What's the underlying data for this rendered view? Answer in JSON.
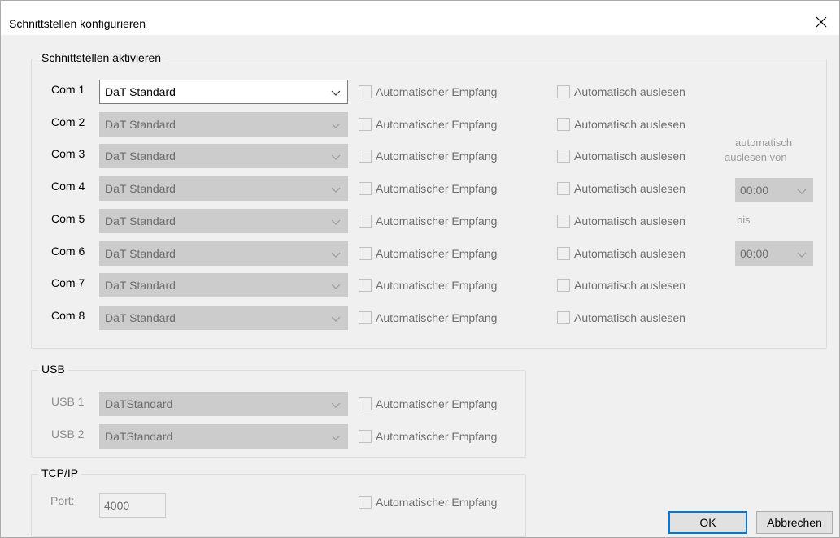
{
  "window": {
    "title": "Schnittstellen konfigurieren"
  },
  "com_group": {
    "legend": "Schnittstellen aktivieren",
    "rows": [
      {
        "label": "Com 1",
        "protocol": "DaT Standard",
        "auto_receive": "Automatischer Empfang",
        "auto_read": "Automatisch auslesen"
      },
      {
        "label": "Com 2",
        "protocol": "DaT Standard",
        "auto_receive": "Automatischer Empfang",
        "auto_read": "Automatisch auslesen"
      },
      {
        "label": "Com 3",
        "protocol": "DaT Standard",
        "auto_receive": "Automatischer Empfang",
        "auto_read": "Automatisch auslesen"
      },
      {
        "label": "Com 4",
        "protocol": "DaT Standard",
        "auto_receive": "Automatischer Empfang",
        "auto_read": "Automatisch auslesen"
      },
      {
        "label": "Com 5",
        "protocol": "DaT Standard",
        "auto_receive": "Automatischer Empfang",
        "auto_read": "Automatisch auslesen"
      },
      {
        "label": "Com 6",
        "protocol": "DaT Standard",
        "auto_receive": "Automatischer Empfang",
        "auto_read": "Automatisch auslesen"
      },
      {
        "label": "Com 7",
        "protocol": "DaT Standard",
        "auto_receive": "Automatischer Empfang",
        "auto_read": "Automatisch auslesen"
      },
      {
        "label": "Com 8",
        "protocol": "DaT Standard",
        "auto_receive": "Automatischer Empfang",
        "auto_read": "Automatisch auslesen"
      }
    ],
    "schedule": {
      "from_label_line1": "automatisch",
      "from_label_line2": "auslesen von",
      "from_value": "00:00",
      "to_label": "bis",
      "to_value": "00:00"
    }
  },
  "usb_group": {
    "legend": "USB",
    "rows": [
      {
        "label": "USB 1",
        "protocol": "DaTStandard",
        "auto_receive": "Automatischer Empfang"
      },
      {
        "label": "USB 2",
        "protocol": "DaTStandard",
        "auto_receive": "Automatischer Empfang"
      }
    ]
  },
  "tcp_group": {
    "legend": "TCP/IP",
    "port_label": "Port:",
    "port_value": "4000",
    "auto_receive": "Automatischer Empfang"
  },
  "buttons": {
    "ok": "OK",
    "cancel": "Abbrechen"
  },
  "colors": {
    "default_button_border": "#0078d7",
    "disabled_fill": "#cccccc",
    "dialog_bg": "#f0f0f0"
  },
  "icons": {
    "close": "close-icon",
    "dropdown": "chevron-down-icon",
    "checkbox": "checkbox-unchecked-icon"
  }
}
